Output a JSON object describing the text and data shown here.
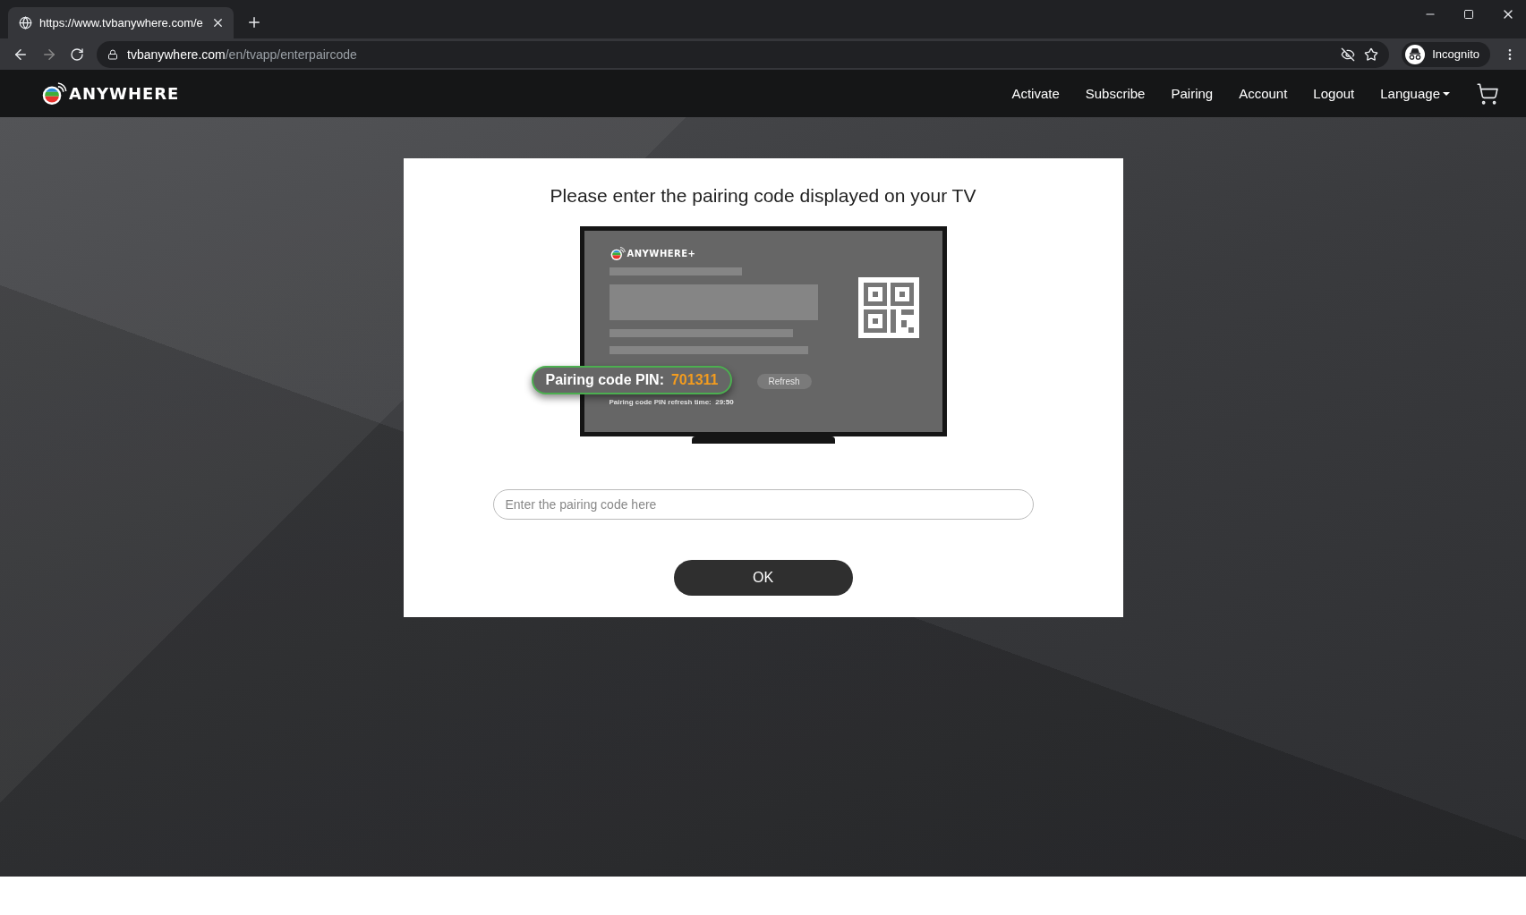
{
  "browser": {
    "tab_title": "https://www.tvbanywhere.com/e",
    "url_host": "tvbanywhere.com",
    "url_path": "/en/tvapp/enterpaircode",
    "profile": "Incognito"
  },
  "nav": {
    "logo": "ANYWHERE",
    "items": [
      "Activate",
      "Subscribe",
      "Pairing",
      "Account",
      "Logout"
    ],
    "language": "Language"
  },
  "card": {
    "title": "Please enter the pairing code displayed on your TV",
    "illustration": {
      "logo": "ANYWHERE+",
      "pin_label": "Pairing code PIN:",
      "pin": "701311",
      "refresh": "Refresh",
      "refresh_time_label": "Pairing code PIN refresh time:",
      "refresh_time": "29:50"
    },
    "input": {
      "placeholder": "Enter the pairing code here"
    },
    "button": "OK"
  }
}
